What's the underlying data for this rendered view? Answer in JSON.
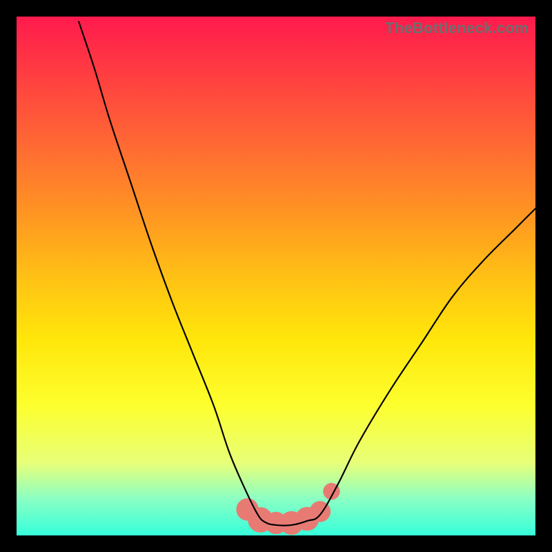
{
  "watermark": "TheBottleneck.com",
  "colors": {
    "gradient_top": "#ff1a4d",
    "gradient_bottom": "#35ffdb",
    "curve": "#000000",
    "blob": "#e77b74",
    "border": "#000000"
  },
  "chart_data": {
    "type": "line",
    "title": "",
    "xlabel": "",
    "ylabel": "",
    "xlim": [
      0,
      100
    ],
    "ylim": [
      0,
      100
    ],
    "series": [
      {
        "name": "left-curve",
        "x": [
          12,
          15,
          18,
          22,
          26,
          30,
          34,
          38,
          41,
          44,
          46.5
        ],
        "y": [
          99,
          90,
          80,
          68,
          56,
          45,
          35,
          25,
          16,
          9,
          4
        ]
      },
      {
        "name": "valley",
        "x": [
          46.5,
          48,
          50,
          53,
          56,
          58.5
        ],
        "y": [
          4,
          2.5,
          2,
          2,
          2.8,
          4
        ]
      },
      {
        "name": "right-curve",
        "x": [
          58.5,
          62,
          66,
          72,
          78,
          84,
          90,
          96,
          100
        ],
        "y": [
          4,
          10,
          18,
          28,
          37,
          46,
          53,
          59,
          63
        ]
      }
    ],
    "blobs": [
      {
        "cx": 44.5,
        "cy": 5.0,
        "r": 1.6
      },
      {
        "cx": 47.0,
        "cy": 3.0,
        "r": 1.8
      },
      {
        "cx": 50.0,
        "cy": 2.4,
        "r": 1.6
      },
      {
        "cx": 53.0,
        "cy": 2.4,
        "r": 1.7
      },
      {
        "cx": 56.0,
        "cy": 3.2,
        "r": 1.7
      },
      {
        "cx": 58.5,
        "cy": 4.6,
        "r": 1.5
      },
      {
        "cx": 60.7,
        "cy": 8.5,
        "r": 1.2
      }
    ]
  }
}
